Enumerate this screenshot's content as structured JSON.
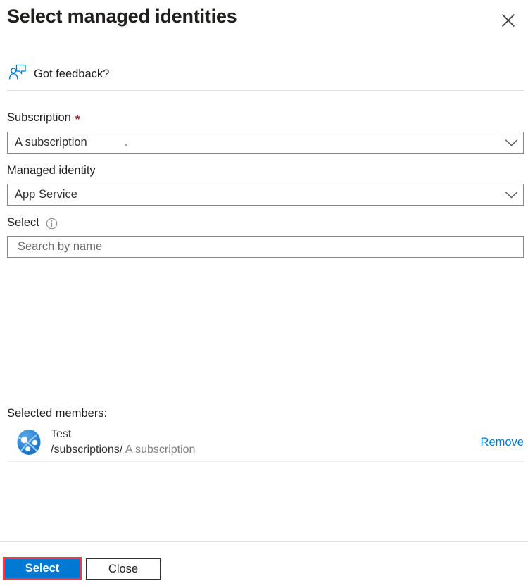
{
  "dialog": {
    "title": "Select managed identities",
    "close_icon": "close-icon"
  },
  "feedback": {
    "label": "Got feedback?",
    "icon": "feedback-person-icon"
  },
  "form": {
    "subscription": {
      "label": "Subscription",
      "required_marker": "*",
      "value": "A subscription",
      "chevron_icon": "chevron-down-icon"
    },
    "managed_identity": {
      "label": "Managed identity",
      "value": "App Service",
      "chevron_icon": "chevron-down-icon"
    },
    "select": {
      "label": "Select",
      "info_icon": "info-icon",
      "search_placeholder": "Search by name",
      "search_value": ""
    }
  },
  "selected_members": {
    "heading": "Selected members:",
    "members": [
      {
        "name": "Test",
        "path_prefix": "/subscriptions/",
        "path_suffix": " A subscription",
        "avatar_icon": "managed-identity-avatar-icon",
        "remove_label": "Remove"
      }
    ]
  },
  "footer": {
    "select_label": "Select",
    "close_label": "Close"
  },
  "colors": {
    "accent": "#0078d4",
    "highlight": "#fb3640",
    "required": "#a4262c",
    "border": "#8a8886",
    "divider": "#e1dfdd",
    "text": "#201f1e",
    "muted": "#807f7d"
  }
}
